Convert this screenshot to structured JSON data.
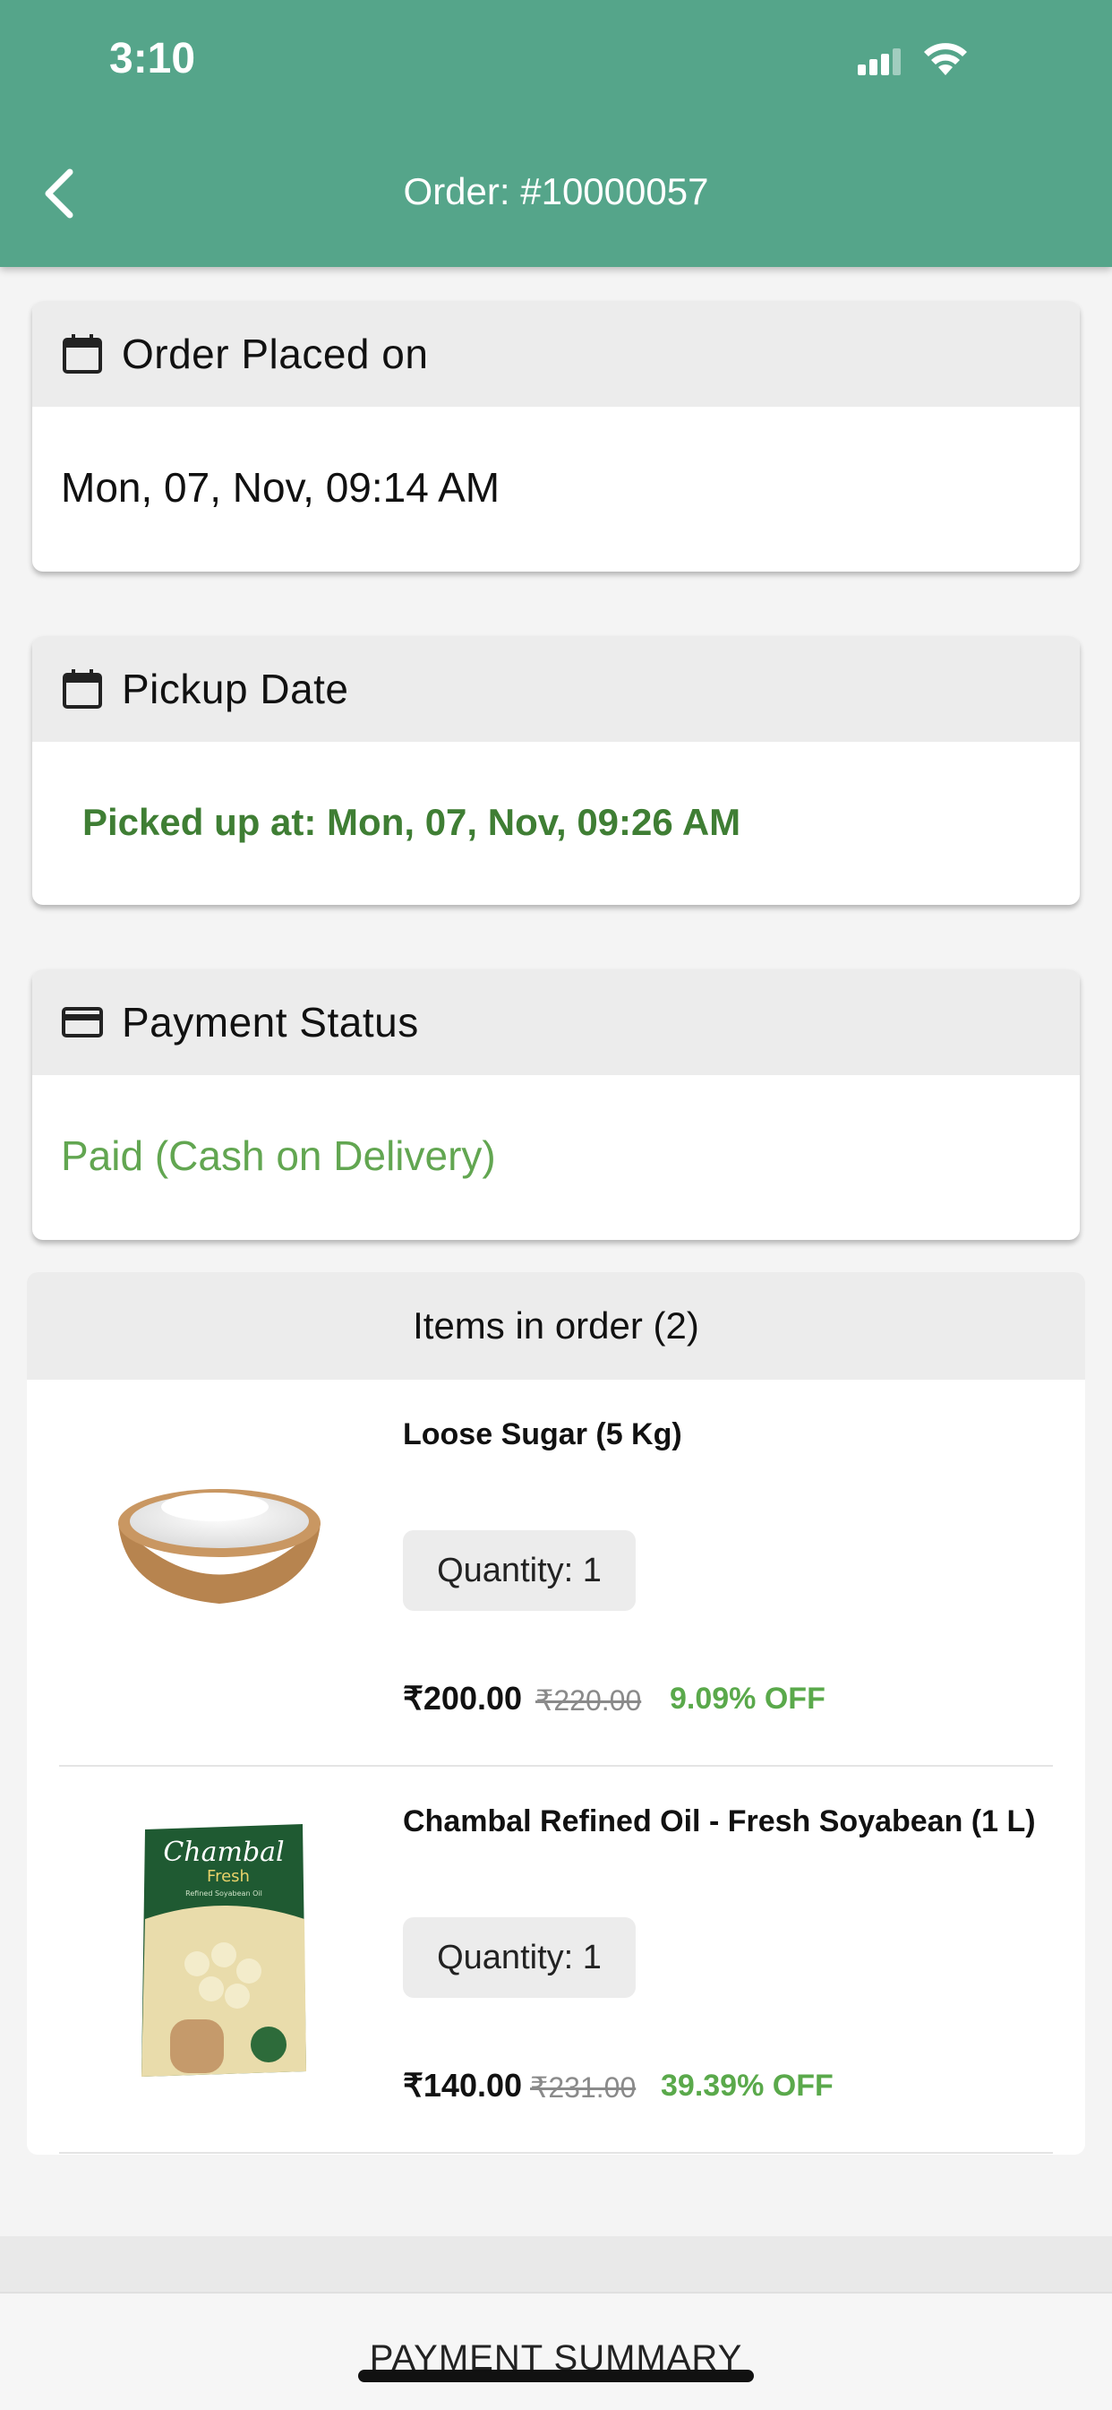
{
  "status_bar": {
    "time": "3:10"
  },
  "header": {
    "title": "Order: #10000057"
  },
  "order_placed": {
    "label": "Order Placed on",
    "value": "Mon, 07, Nov, 09:14 AM"
  },
  "pickup": {
    "label": "Pickup Date",
    "value": "Picked up at: Mon, 07, Nov, 09:26 AM"
  },
  "payment": {
    "label": "Payment Status",
    "value": "Paid (Cash on Delivery)"
  },
  "items": {
    "title": "Items in order (2)",
    "list": [
      {
        "name": "Loose Sugar (5 Kg)",
        "quantity": "Quantity: 1",
        "price": "₹200.00",
        "mrp": "₹220.00",
        "discount": "9.09% OFF"
      },
      {
        "name": "Chambal Refined Oil - Fresh Soyabean (1 L)",
        "quantity": "Quantity: 1",
        "price": "₹140.00",
        "mrp": "₹231.00",
        "discount": "39.39% OFF"
      }
    ]
  },
  "product_image_text": {
    "brand": "Chambal",
    "variant": "Fresh",
    "sub": "Refined Soyabean Oil"
  },
  "summary": {
    "title": "PAYMENT SUMMARY"
  },
  "colors": {
    "header": "#55a58a",
    "green_dark": "#3f7e34",
    "green_light": "#62a651"
  }
}
